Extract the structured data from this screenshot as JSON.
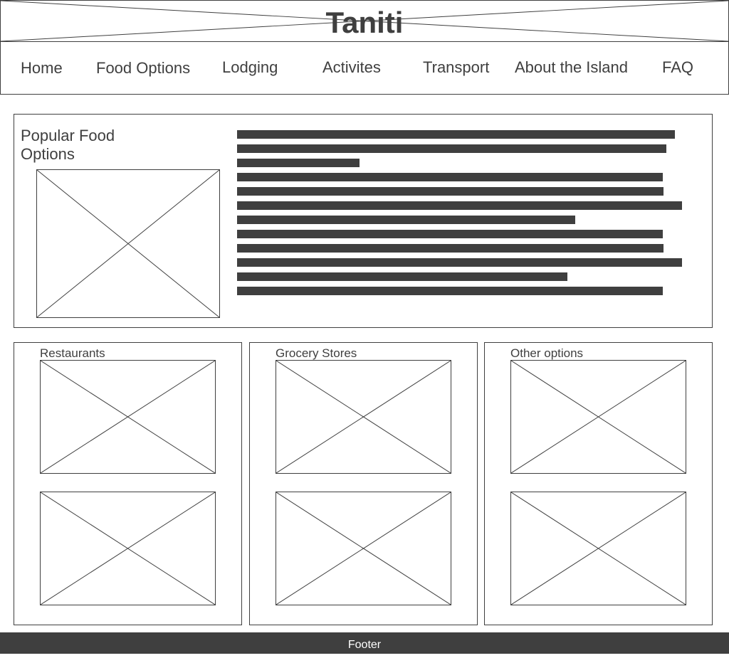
{
  "header": {
    "site_title": "Taniti"
  },
  "nav": {
    "items": [
      {
        "label": "Home"
      },
      {
        "label": "Food Options"
      },
      {
        "label": "Lodging"
      },
      {
        "label": "Activites"
      },
      {
        "label": "Transport"
      },
      {
        "label": "About the Island"
      },
      {
        "label": "FAQ"
      }
    ]
  },
  "hero": {
    "title": "Popular Food Options",
    "image_icon": "image-placeholder-icon"
  },
  "cards": [
    {
      "title": "Restaurants"
    },
    {
      "title": "Grocery Stores"
    },
    {
      "title": "Other options"
    }
  ],
  "footer": {
    "label": "Footer"
  },
  "colors": {
    "ink": "#3f3f3f",
    "background": "#ffffff",
    "footer_text": "#ffffff"
  }
}
